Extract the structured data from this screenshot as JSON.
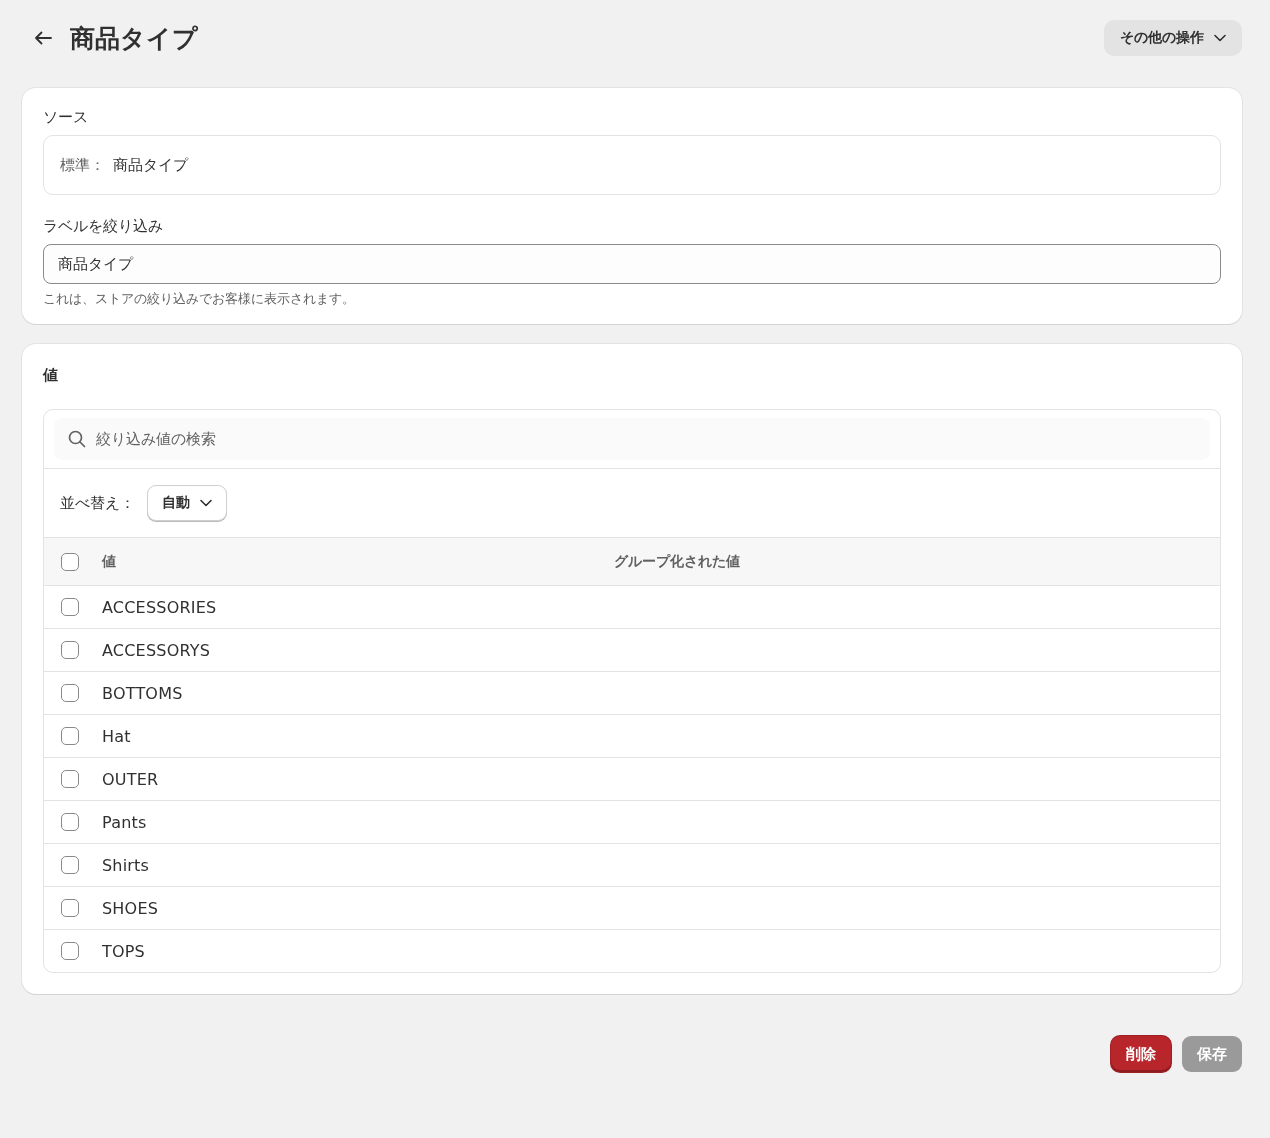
{
  "header": {
    "title": "商品タイプ",
    "actions_button": "その他の操作"
  },
  "source_card": {
    "label": "ソース",
    "field": {
      "prefix": "標準：",
      "value": "商品タイプ"
    }
  },
  "filter_label": {
    "label": "ラベルを絞り込み",
    "value": "商品タイプ",
    "help": "これは、ストアの絞り込みでお客様に表示されます。"
  },
  "values_card": {
    "title": "値",
    "search": {
      "placeholder": "絞り込み値の検索"
    },
    "sort": {
      "label": "並べ替え：",
      "value": "自動"
    },
    "table": {
      "select_all": {
        "checked": false
      },
      "columns": [
        "値",
        "グループ化された値"
      ],
      "rows": [
        {
          "value": "ACCESSORIES",
          "checked": false
        },
        {
          "value": "ACCESSORYS",
          "checked": false
        },
        {
          "value": "BOTTOMS",
          "checked": false
        },
        {
          "value": "Hat",
          "checked": false
        },
        {
          "value": "OUTER",
          "checked": false
        },
        {
          "value": "Pants",
          "checked": false
        },
        {
          "value": "Shirts",
          "checked": false
        },
        {
          "value": "SHOES",
          "checked": false
        },
        {
          "value": "TOPS",
          "checked": false
        }
      ]
    }
  },
  "footer": {
    "buttons": [
      {
        "label": "削除",
        "kind": "critical",
        "disabled": false
      },
      {
        "label": "保存",
        "kind": "primary",
        "disabled": true
      }
    ]
  }
}
